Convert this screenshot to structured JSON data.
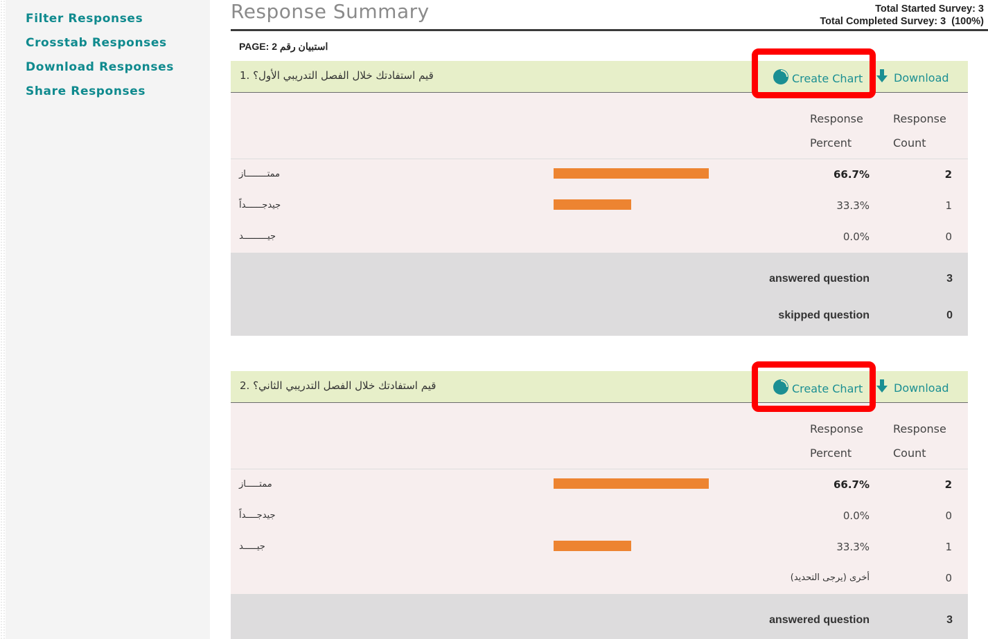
{
  "sidebar": {
    "items": [
      {
        "label": "Filter Responses"
      },
      {
        "label": "Crosstab Responses"
      },
      {
        "label": "Download Responses"
      },
      {
        "label": "Share Responses"
      }
    ]
  },
  "header": {
    "title": "Response Summary",
    "total_started": "Total Started Survey: 3",
    "total_completed": "Total Completed Survey: 3  (100%)"
  },
  "page_label": "PAGE: 2 استبيان رقم",
  "actions": {
    "create_chart": "Create Chart",
    "download": "Download"
  },
  "columns": {
    "percent_line1": "Response",
    "percent_line2": "Percent",
    "count_line1": "Response",
    "count_line2": "Count"
  },
  "colors": {
    "accent": "#1b8f93",
    "bar": "#ed8431",
    "highlight": "#ff0000"
  },
  "questions": [
    {
      "title": "قيم استفادتك خلال الفصل التدريبي الأول؟ .1",
      "rows": [
        {
          "label": "ممتــــــــاز",
          "percent": "66.7%",
          "count": "2",
          "fraction": 0.667
        },
        {
          "label": "جيدجــــــداً",
          "percent": "33.3%",
          "count": "1",
          "fraction": 0.333
        },
        {
          "label": "جيـــــــــد",
          "percent": "0.0%",
          "count": "0",
          "fraction": 0
        }
      ],
      "answered_label": "answered question",
      "answered_value": "3",
      "skipped_label": "skipped question",
      "skipped_value": "0"
    },
    {
      "title": "قيم استفادتك خلال الفصل التدريبي الثاني؟ .2",
      "rows": [
        {
          "label": "ممتـــــاز",
          "percent": "66.7%",
          "count": "2",
          "fraction": 0.667
        },
        {
          "label": "جيدجــــداً",
          "percent": "0.0%",
          "count": "0",
          "fraction": 0
        },
        {
          "label": "جيـــــد",
          "percent": "33.3%",
          "count": "1",
          "fraction": 0.333
        }
      ],
      "other_label": "(أخرى (يرجى التحديد",
      "other_count": "0",
      "answered_label": "answered question",
      "answered_value": "3"
    }
  ]
}
